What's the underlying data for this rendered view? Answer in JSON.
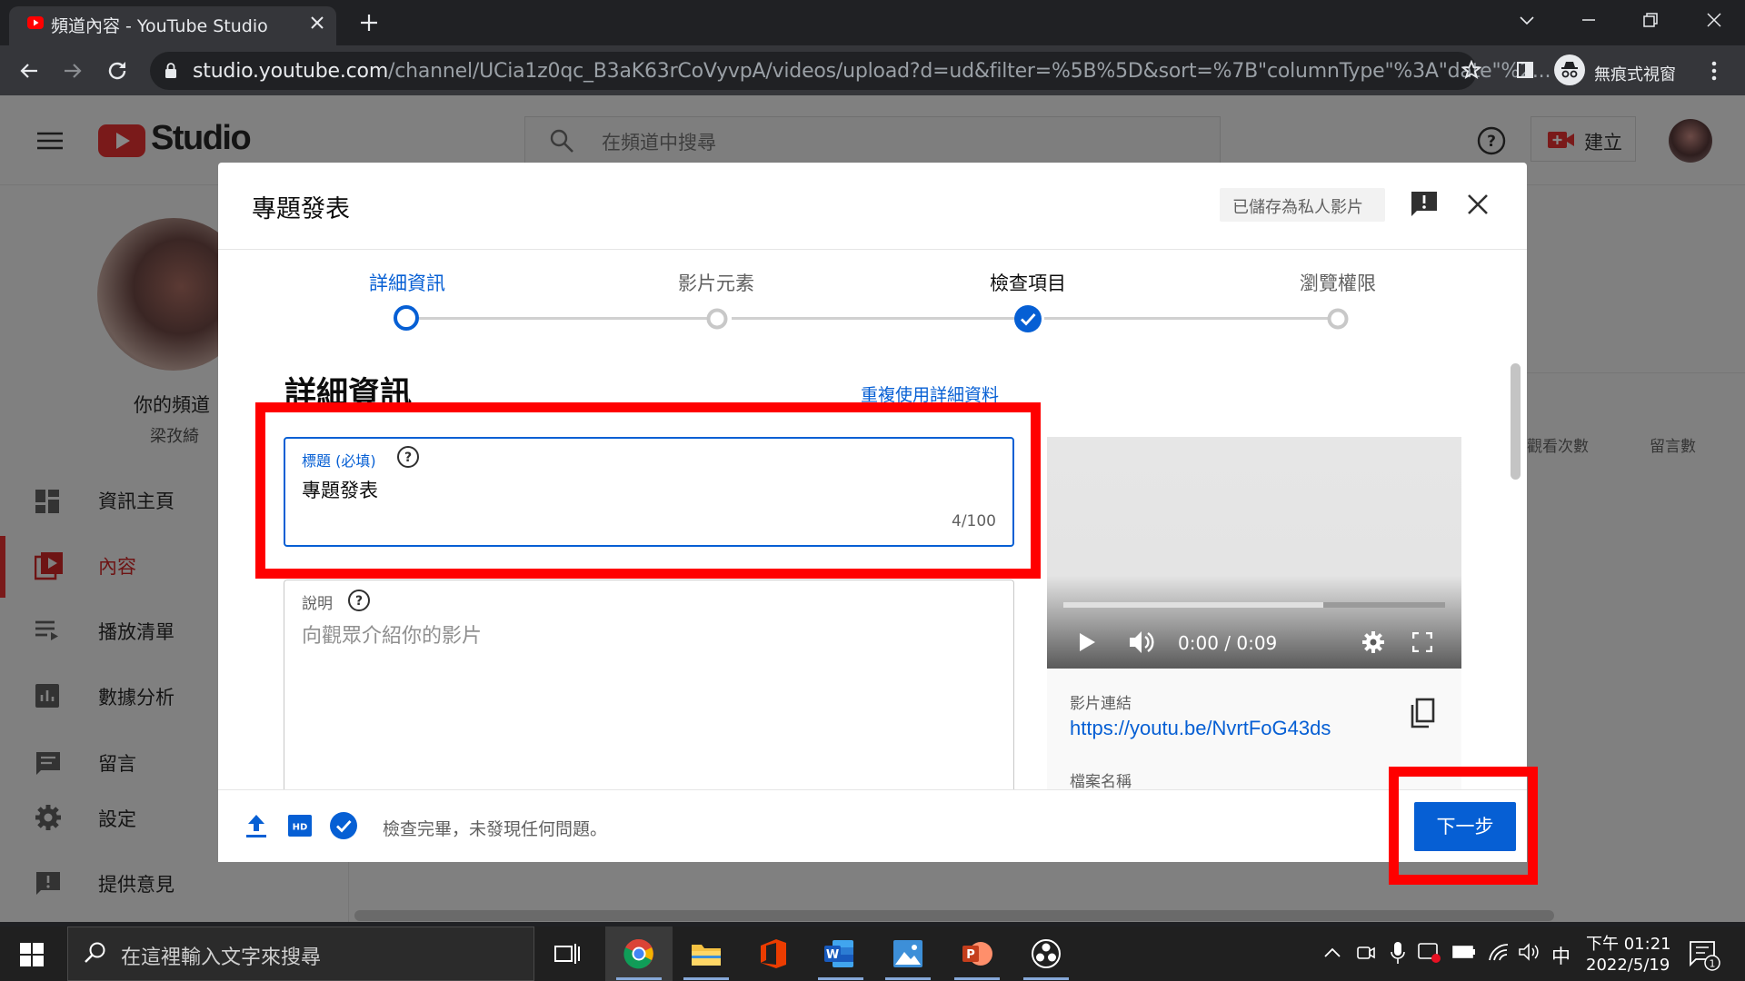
{
  "browser": {
    "tab_title": "頻道內容 - YouTube Studio",
    "url_host": "studio.youtube.com",
    "url_path": "/channel/UCia1z0qc_B3aK63rCoVyvpA/videos/upload?d=ud&filter=%5B%5D&sort=%7B\"columnType\"%3A\"date\"%2...",
    "incognito_label": "無痕式視窗"
  },
  "studio": {
    "logo_text": "Studio",
    "search_placeholder": "在頻道中搜尋",
    "create_label": "建立",
    "your_channel": "你的頻道",
    "channel_name": "梁孜綺",
    "nav": [
      {
        "label": "資訊主頁",
        "icon": "dashboard-icon"
      },
      {
        "label": "內容",
        "icon": "content-icon",
        "active": true
      },
      {
        "label": "播放清單",
        "icon": "playlist-icon"
      },
      {
        "label": "數據分析",
        "icon": "analytics-icon"
      },
      {
        "label": "留言",
        "icon": "comments-icon"
      },
      {
        "label": "設定",
        "icon": "settings-icon"
      },
      {
        "label": "提供意見",
        "icon": "feedback-icon"
      }
    ],
    "columns": [
      "觀看次數",
      "留言數"
    ]
  },
  "dialog": {
    "title": "專題發表",
    "saved_status": "已儲存為私人影片",
    "steps": [
      {
        "label": "詳細資訊",
        "state": "current"
      },
      {
        "label": "影片元素",
        "state": "pending"
      },
      {
        "label": "檢查項目",
        "state": "done"
      },
      {
        "label": "瀏覽權限",
        "state": "pending"
      }
    ],
    "section_title": "詳細資訊",
    "reuse_link": "重複使用詳細資料",
    "title_field": {
      "label": "標題 (必填)",
      "value": "專題發表",
      "counter": "4/100"
    },
    "description_field": {
      "label": "說明",
      "placeholder": "向觀眾介紹你的影片"
    },
    "video": {
      "time": "0:00 / 0:09",
      "progress": 0.68
    },
    "video_link_label": "影片連結",
    "video_link": "https://youtu.be/NvrtFoG43ds",
    "filename_label": "檔案名稱",
    "footer_status": "檢查完畢，未發現任何問題。",
    "next_label": "下一步",
    "hd_badge": "HD"
  },
  "taskbar": {
    "search_placeholder": "在這裡輸入文字來搜尋",
    "ime": "中",
    "time": "下午 01:21",
    "date": "2022/5/19",
    "notification_count": "1"
  },
  "colors": {
    "accent_blue": "#065fd4",
    "highlight_red": "#ff0000",
    "youtube_red": "#ff0000"
  }
}
